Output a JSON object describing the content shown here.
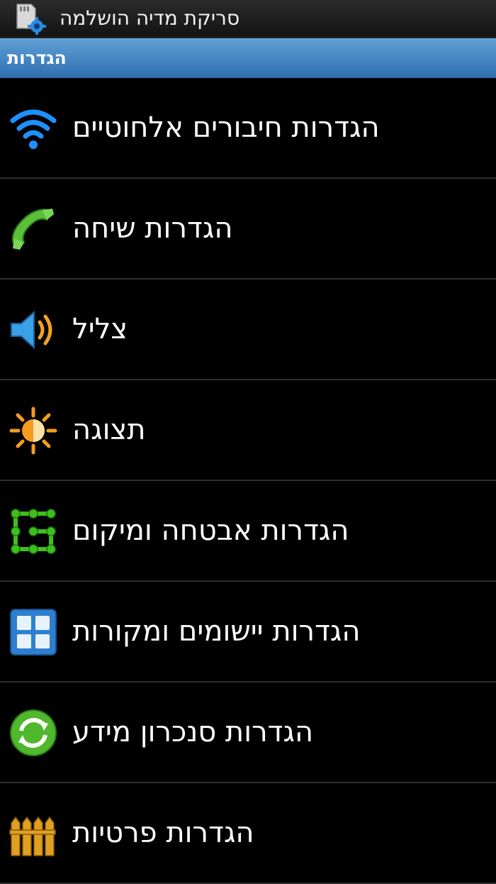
{
  "status_bar": {
    "title": "סריקת מדיה הושלמה",
    "icon": "sd-card-gear-icon"
  },
  "section": {
    "title": "הגדרות"
  },
  "items": [
    {
      "label": "הגדרות חיבורים אלחוטיים",
      "icon": "wifi-icon",
      "color": "#1e90ff"
    },
    {
      "label": "הגדרות שיחה",
      "icon": "phone-handset-icon",
      "color": "#5bbf3a"
    },
    {
      "label": "צליל",
      "icon": "speaker-icon",
      "color": "#3aa0e8"
    },
    {
      "label": "תצוגה",
      "icon": "brightness-icon",
      "color": "#f39c1e"
    },
    {
      "label": "הגדרות אבטחה ומיקום",
      "icon": "pattern-lock-icon",
      "color": "#3fbf1e"
    },
    {
      "label": "הגדרות יישומים ומקורות",
      "icon": "apps-grid-icon",
      "color": "#2f7fd0"
    },
    {
      "label": "הגדרות סנכרון מידע",
      "icon": "sync-icon",
      "color": "#4fb82c"
    },
    {
      "label": "הגדרות פרטיות",
      "icon": "privacy-fence-icon",
      "color": "#e0a020"
    }
  ]
}
